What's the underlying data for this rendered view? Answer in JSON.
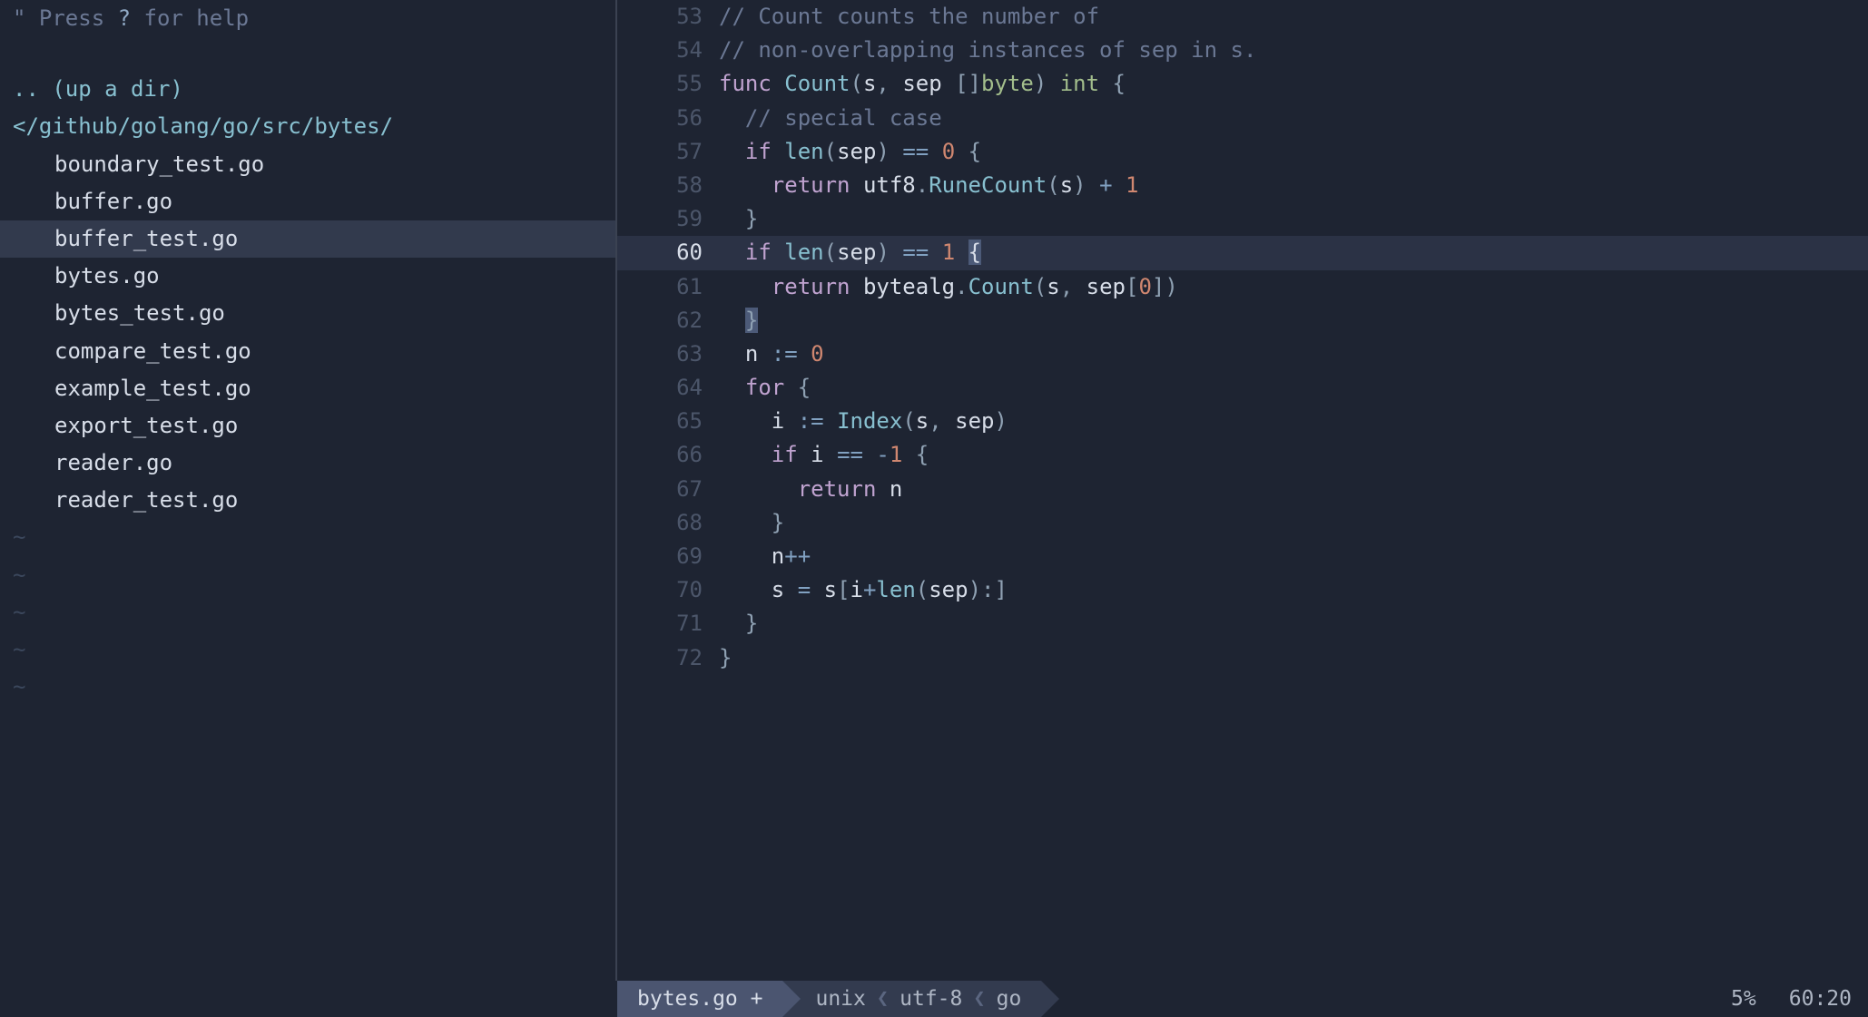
{
  "sidebar": {
    "help_prefix": "\" Press ",
    "help_key": "?",
    "help_suffix": " for help",
    "updir": ".. (up a dir)",
    "path": "</github/golang/go/src/bytes/",
    "files": [
      "boundary_test.go",
      "buffer.go",
      "buffer_test.go",
      "bytes.go",
      "bytes_test.go",
      "compare_test.go",
      "example_test.go",
      "export_test.go",
      "reader.go",
      "reader_test.go"
    ],
    "selected_index": 2,
    "tilde_count": 5
  },
  "editor": {
    "lines": [
      {
        "n": 53,
        "tokens": [
          {
            "cls": "c-comment",
            "t": "// Count counts the number of"
          }
        ]
      },
      {
        "n": 54,
        "tokens": [
          {
            "cls": "c-comment",
            "t": "// non-overlapping instances of sep in s."
          }
        ]
      },
      {
        "n": 55,
        "tokens": [
          {
            "cls": "c-keyword",
            "t": "func "
          },
          {
            "cls": "c-func",
            "t": "Count"
          },
          {
            "cls": "c-punc",
            "t": "("
          },
          {
            "cls": "c-ident",
            "t": "s"
          },
          {
            "cls": "c-punc",
            "t": ", "
          },
          {
            "cls": "c-ident",
            "t": "sep "
          },
          {
            "cls": "c-punc",
            "t": "[]"
          },
          {
            "cls": "c-type",
            "t": "byte"
          },
          {
            "cls": "c-punc",
            "t": ") "
          },
          {
            "cls": "c-type",
            "t": "int"
          },
          {
            "cls": "c-punc",
            "t": " {"
          }
        ]
      },
      {
        "n": 56,
        "tokens": [
          {
            "cls": "c-plain",
            "t": "  "
          },
          {
            "cls": "c-comment",
            "t": "// special case"
          }
        ]
      },
      {
        "n": 57,
        "tokens": [
          {
            "cls": "c-plain",
            "t": "  "
          },
          {
            "cls": "c-keyword",
            "t": "if "
          },
          {
            "cls": "c-func",
            "t": "len"
          },
          {
            "cls": "c-punc",
            "t": "("
          },
          {
            "cls": "c-ident",
            "t": "sep"
          },
          {
            "cls": "c-punc",
            "t": ") "
          },
          {
            "cls": "c-op",
            "t": "== "
          },
          {
            "cls": "c-num",
            "t": "0"
          },
          {
            "cls": "c-punc",
            "t": " {"
          }
        ]
      },
      {
        "n": 58,
        "tokens": [
          {
            "cls": "c-plain",
            "t": "    "
          },
          {
            "cls": "c-keyword",
            "t": "return "
          },
          {
            "cls": "c-ident",
            "t": "utf8"
          },
          {
            "cls": "c-punc",
            "t": "."
          },
          {
            "cls": "c-func",
            "t": "RuneCount"
          },
          {
            "cls": "c-punc",
            "t": "("
          },
          {
            "cls": "c-ident",
            "t": "s"
          },
          {
            "cls": "c-punc",
            "t": ") "
          },
          {
            "cls": "c-op",
            "t": "+ "
          },
          {
            "cls": "c-num",
            "t": "1"
          }
        ]
      },
      {
        "n": 59,
        "tokens": [
          {
            "cls": "c-plain",
            "t": "  "
          },
          {
            "cls": "c-punc",
            "t": "}"
          }
        ]
      },
      {
        "n": 60,
        "current": true,
        "tokens": [
          {
            "cls": "c-plain",
            "t": "  "
          },
          {
            "cls": "c-keyword",
            "t": "if "
          },
          {
            "cls": "c-func",
            "t": "len"
          },
          {
            "cls": "c-punc",
            "t": "("
          },
          {
            "cls": "c-ident",
            "t": "sep"
          },
          {
            "cls": "c-punc",
            "t": ") "
          },
          {
            "cls": "c-op",
            "t": "== "
          },
          {
            "cls": "c-num",
            "t": "1"
          },
          {
            "cls": "c-plain",
            "t": " "
          },
          {
            "cls": "cursor-block",
            "t": "{"
          }
        ]
      },
      {
        "n": 61,
        "tokens": [
          {
            "cls": "c-plain",
            "t": "    "
          },
          {
            "cls": "c-keyword",
            "t": "return "
          },
          {
            "cls": "c-ident",
            "t": "bytealg"
          },
          {
            "cls": "c-punc",
            "t": "."
          },
          {
            "cls": "c-func",
            "t": "Count"
          },
          {
            "cls": "c-punc",
            "t": "("
          },
          {
            "cls": "c-ident",
            "t": "s"
          },
          {
            "cls": "c-punc",
            "t": ", "
          },
          {
            "cls": "c-ident",
            "t": "sep"
          },
          {
            "cls": "c-punc",
            "t": "["
          },
          {
            "cls": "c-num",
            "t": "0"
          },
          {
            "cls": "c-punc",
            "t": "])"
          }
        ]
      },
      {
        "n": 62,
        "tokens": [
          {
            "cls": "c-plain",
            "t": "  "
          },
          {
            "cls": "hl-brace c-punc",
            "t": "}"
          }
        ]
      },
      {
        "n": 63,
        "tokens": [
          {
            "cls": "c-plain",
            "t": "  "
          },
          {
            "cls": "c-ident",
            "t": "n "
          },
          {
            "cls": "c-op",
            "t": ":= "
          },
          {
            "cls": "c-num",
            "t": "0"
          }
        ]
      },
      {
        "n": 64,
        "tokens": [
          {
            "cls": "c-plain",
            "t": "  "
          },
          {
            "cls": "c-keyword",
            "t": "for "
          },
          {
            "cls": "c-punc",
            "t": "{"
          }
        ]
      },
      {
        "n": 65,
        "tokens": [
          {
            "cls": "c-plain",
            "t": "    "
          },
          {
            "cls": "c-ident",
            "t": "i "
          },
          {
            "cls": "c-op",
            "t": ":= "
          },
          {
            "cls": "c-func",
            "t": "Index"
          },
          {
            "cls": "c-punc",
            "t": "("
          },
          {
            "cls": "c-ident",
            "t": "s"
          },
          {
            "cls": "c-punc",
            "t": ", "
          },
          {
            "cls": "c-ident",
            "t": "sep"
          },
          {
            "cls": "c-punc",
            "t": ")"
          }
        ]
      },
      {
        "n": 66,
        "tokens": [
          {
            "cls": "c-plain",
            "t": "    "
          },
          {
            "cls": "c-keyword",
            "t": "if "
          },
          {
            "cls": "c-ident",
            "t": "i "
          },
          {
            "cls": "c-op",
            "t": "== -"
          },
          {
            "cls": "c-num",
            "t": "1"
          },
          {
            "cls": "c-punc",
            "t": " {"
          }
        ]
      },
      {
        "n": 67,
        "tokens": [
          {
            "cls": "c-plain",
            "t": "      "
          },
          {
            "cls": "c-keyword",
            "t": "return "
          },
          {
            "cls": "c-ident",
            "t": "n"
          }
        ]
      },
      {
        "n": 68,
        "tokens": [
          {
            "cls": "c-plain",
            "t": "    "
          },
          {
            "cls": "c-punc",
            "t": "}"
          }
        ]
      },
      {
        "n": 69,
        "tokens": [
          {
            "cls": "c-plain",
            "t": "    "
          },
          {
            "cls": "c-ident",
            "t": "n"
          },
          {
            "cls": "c-op",
            "t": "++"
          }
        ]
      },
      {
        "n": 70,
        "tokens": [
          {
            "cls": "c-plain",
            "t": "    "
          },
          {
            "cls": "c-ident",
            "t": "s "
          },
          {
            "cls": "c-op",
            "t": "= "
          },
          {
            "cls": "c-ident",
            "t": "s"
          },
          {
            "cls": "c-punc",
            "t": "["
          },
          {
            "cls": "c-ident",
            "t": "i"
          },
          {
            "cls": "c-op",
            "t": "+"
          },
          {
            "cls": "c-func",
            "t": "len"
          },
          {
            "cls": "c-punc",
            "t": "("
          },
          {
            "cls": "c-ident",
            "t": "sep"
          },
          {
            "cls": "c-punc",
            "t": "):]"
          }
        ]
      },
      {
        "n": 71,
        "tokens": [
          {
            "cls": "c-plain",
            "t": "  "
          },
          {
            "cls": "c-punc",
            "t": "}"
          }
        ]
      },
      {
        "n": 72,
        "tokens": [
          {
            "cls": "c-punc",
            "t": "}"
          }
        ]
      }
    ]
  },
  "statusbar": {
    "filename": "bytes.go +",
    "fileformat": "unix",
    "encoding": "utf-8",
    "filetype": "go",
    "percent": "5%",
    "position": "60:20"
  }
}
